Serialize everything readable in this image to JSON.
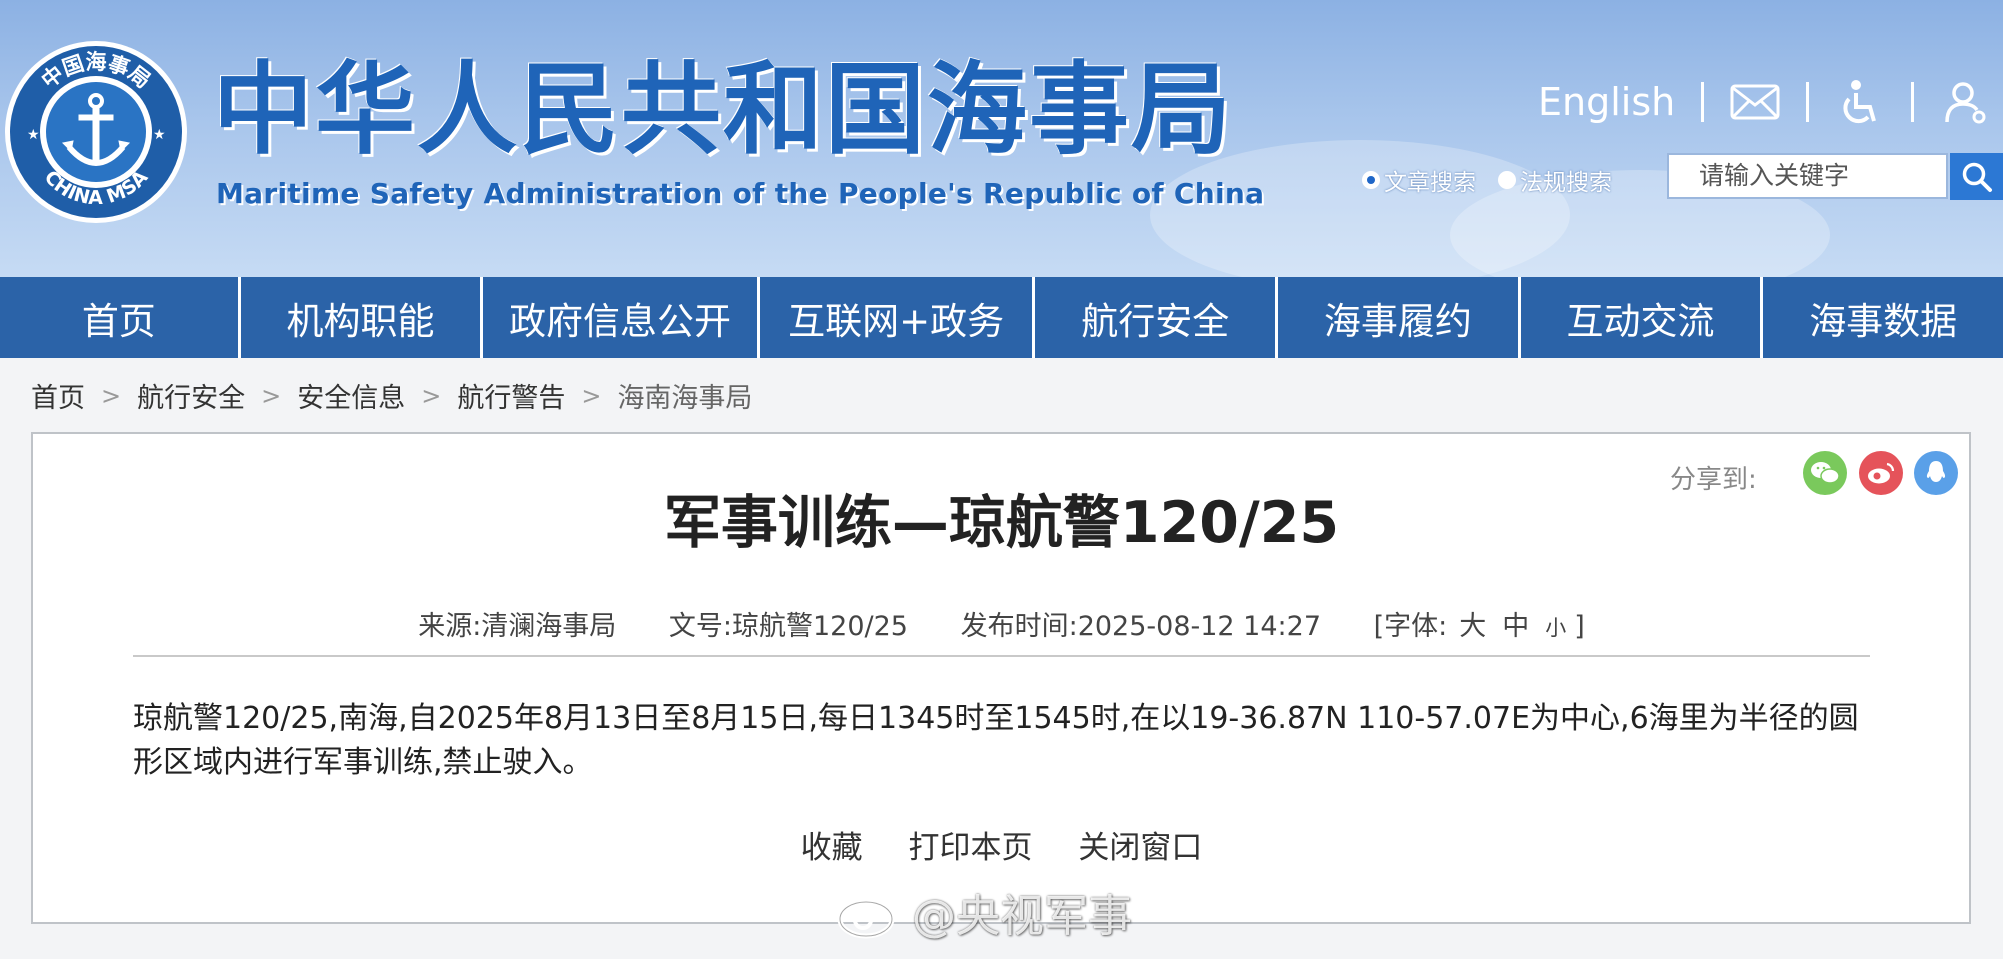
{
  "header": {
    "title_cn": "中华人民共和国海事局",
    "title_en": "Maritime Safety Administration of the People's Republic of China",
    "emblem_text_top": "中国海事局",
    "emblem_text_bottom": "CHINA MSA",
    "english_link": "English",
    "icons": [
      "mail-icon",
      "accessibility-icon",
      "user-icon"
    ],
    "search": {
      "options": [
        "文章搜索",
        "法规搜索"
      ],
      "selected": "文章搜索",
      "placeholder": "请输入关键字"
    }
  },
  "nav": {
    "items": [
      "首页",
      "机构职能",
      "政府信息公开",
      "互联网+政务",
      "航行安全",
      "海事履约",
      "互动交流",
      "海事数据"
    ]
  },
  "breadcrumb": [
    "首页",
    "航行安全",
    "安全信息",
    "航行警告",
    "海南海事局"
  ],
  "article": {
    "share_label": "分享到:",
    "title": "军事训练—琼航警120/25",
    "source": "来源:清澜海事局",
    "doc_no": "文号:琼航警120/25",
    "published": "发布时间:2025-08-12 14:27",
    "font_label": "[字体:",
    "font_large": "大",
    "font_medium": "中",
    "font_small": "小",
    "font_close": "]",
    "body": "琼航警120/25,南海,自2025年8月13日至8月15日,每日1345时至1545时,在以19-36.87N 110-57.07E为中心,6海里为半径的圆形区域内进行军事训练,禁止驶入。",
    "actions": [
      "收藏",
      "打印本页",
      "关闭窗口"
    ]
  },
  "watermark": "@央视军事",
  "colors": {
    "nav": "#2b63a8",
    "title_blue": "#1f64b8",
    "wechat": "#7ac95c",
    "weibo": "#e5535a",
    "qq": "#5aa0e8"
  }
}
